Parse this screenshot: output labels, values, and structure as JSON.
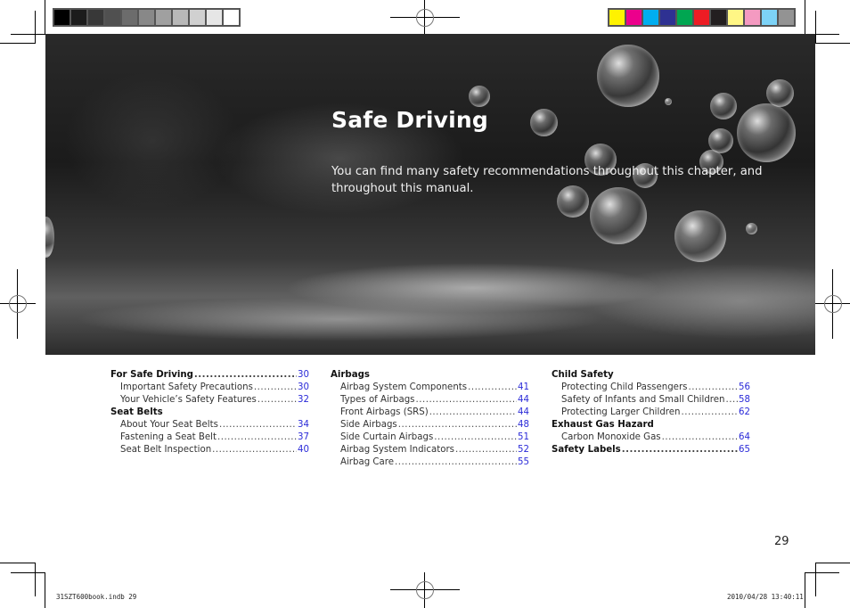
{
  "color_bars": {
    "grayscale": [
      "#000000",
      "#1c1c1c",
      "#383838",
      "#505050",
      "#6c6c6c",
      "#888888",
      "#a0a0a0",
      "#b8b8b8",
      "#d0d0d0",
      "#e6e6e6",
      "#ffffff"
    ],
    "process": [
      "#fff200",
      "#ec008c",
      "#00aeef",
      "#2e3192",
      "#00a651",
      "#ed1c24",
      "#231f20",
      "#fff685",
      "#f49ac1",
      "#7dd3f7",
      "#939393"
    ]
  },
  "chapter": {
    "title": "Safe Driving",
    "intro": "You can find many safety recommendations throughout this chapter, and throughout this manual."
  },
  "toc": {
    "columns": [
      [
        {
          "label": "For Safe Driving",
          "page": "30",
          "level": "head"
        },
        {
          "label": "Important Safety Precautions",
          "page": "30",
          "level": "sub"
        },
        {
          "label": "Your Vehicle’s Safety Features",
          "page": "32",
          "level": "sub"
        },
        {
          "label": "Seat Belts",
          "page": "",
          "level": "head"
        },
        {
          "label": "About Your Seat Belts",
          "page": "34",
          "level": "sub"
        },
        {
          "label": "Fastening a Seat Belt",
          "page": "37",
          "level": "sub"
        },
        {
          "label": "Seat Belt Inspection",
          "page": "40",
          "level": "sub"
        }
      ],
      [
        {
          "label": "Airbags",
          "page": "",
          "level": "head"
        },
        {
          "label": "Airbag System Components",
          "page": "41",
          "level": "sub"
        },
        {
          "label": "Types of Airbags",
          "page": "44",
          "level": "sub"
        },
        {
          "label": "Front Airbags (SRS)",
          "page": "44",
          "level": "sub"
        },
        {
          "label": "Side Airbags",
          "page": "48",
          "level": "sub"
        },
        {
          "label": "Side Curtain Airbags",
          "page": "51",
          "level": "sub"
        },
        {
          "label": "Airbag System Indicators",
          "page": "52",
          "level": "sub"
        },
        {
          "label": "Airbag Care",
          "page": "55",
          "level": "sub"
        }
      ],
      [
        {
          "label": "Child Safety",
          "page": "",
          "level": "head"
        },
        {
          "label": "Protecting Child Passengers",
          "page": "56",
          "level": "sub"
        },
        {
          "label": "Safety of Infants and Small Children",
          "page": "58",
          "level": "sub"
        },
        {
          "label": "Protecting Larger Children",
          "page": "62",
          "level": "sub"
        },
        {
          "label": "Exhaust Gas Hazard",
          "page": "",
          "level": "head"
        },
        {
          "label": "Carbon Monoxide Gas",
          "page": "64",
          "level": "sub"
        },
        {
          "label": "Safety Labels",
          "page": "65",
          "level": "head"
        }
      ]
    ]
  },
  "page_number": "29",
  "slug": {
    "file": "31SZT600book.indb   29",
    "datetime": "2010/04/28   13:40:11"
  }
}
